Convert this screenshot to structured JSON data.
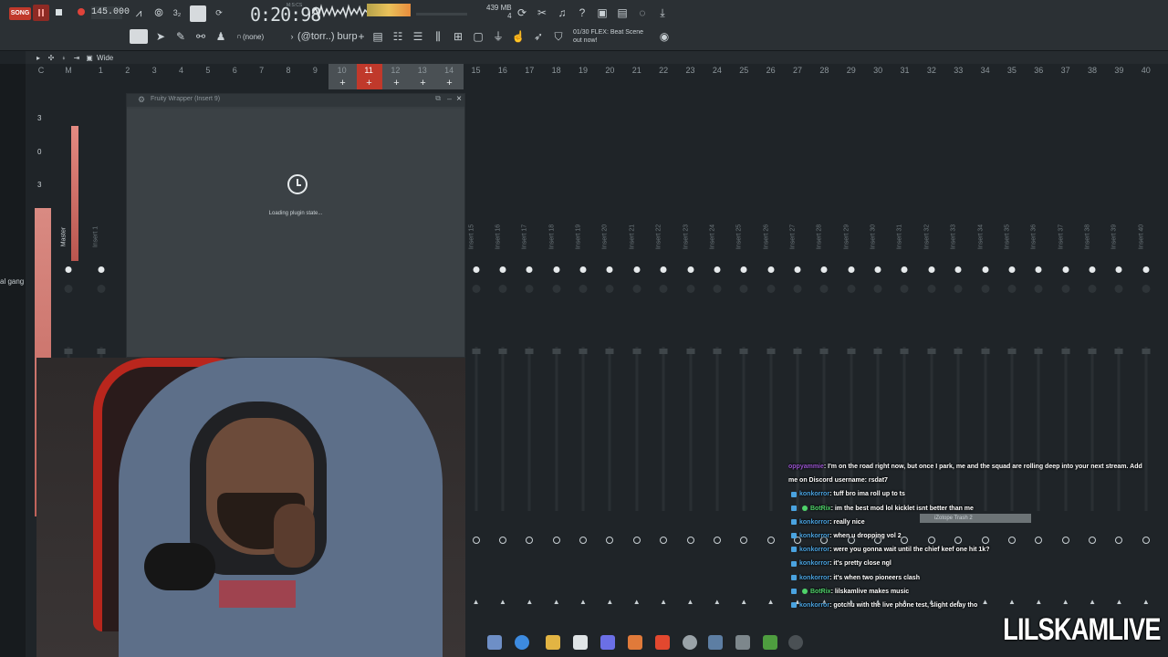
{
  "toolbar": {
    "song_label": "SONG",
    "tempo": "145.000",
    "time": "0:20:98",
    "time_unit": "M:S:CS",
    "memory": "439 MB",
    "cpu_count": "4",
    "snap_label": "(none)",
    "pattern_name": "(@torr..) burp",
    "news_line1": "01/30  FLEX: Beat Scene",
    "news_line2": "out now!",
    "mixer_view": "Wide"
  },
  "mixer": {
    "master_label": "Master",
    "level_marks": [
      "3",
      "0",
      "3"
    ],
    "side_label": "al gang",
    "track_numbers": [
      "C",
      "M",
      "1",
      "2",
      "3",
      "4",
      "5",
      "6",
      "7",
      "8",
      "9",
      "10",
      "11",
      "12",
      "13",
      "14",
      "15",
      "16",
      "17",
      "18",
      "19",
      "20",
      "21",
      "22",
      "23",
      "24",
      "25",
      "26",
      "27",
      "28",
      "29",
      "30",
      "31",
      "32",
      "33",
      "34",
      "35",
      "36",
      "37",
      "38",
      "39",
      "40"
    ],
    "insert_labels": [
      "Insert 1",
      "Insert 15",
      "Insert 16",
      "Insert 17",
      "Insert 18",
      "Insert 19",
      "Insert 20",
      "Insert 21",
      "Insert 22",
      "Insert 23",
      "Insert 24",
      "Insert 25",
      "Insert 26",
      "Insert 27",
      "Insert 28",
      "Insert 29",
      "Insert 30",
      "Insert 31",
      "Insert 32",
      "Insert 33",
      "Insert 34",
      "Insert 35",
      "Insert 36",
      "Insert 37",
      "Insert 38",
      "Insert 39",
      "Insert 40"
    ],
    "selected_track": "11",
    "tooltip": "iZotope Trash 2"
  },
  "wrapper": {
    "title": "Fruity Wrapper (Insert 9)",
    "loading_text": "Loading plugin state..."
  },
  "chat": [
    {
      "user": "oppyammie",
      "text": ": I'm on the road right now, but once I park, me and the squad are rolling deep into your next stream. Add",
      "style": "purple"
    },
    {
      "user": "",
      "text": "me on Discord username: rsdat7",
      "style": "none"
    },
    {
      "user": "konkorror",
      "text": ": tuff bro ima roll up to ts",
      "style": "blue"
    },
    {
      "user": "BotRix",
      "text": ": im the best mod lol kicklet isnt better than me",
      "style": "bot"
    },
    {
      "user": "konkorror",
      "text": ": really nice",
      "style": "blue"
    },
    {
      "user": "konkorror",
      "text": ": when u dropping vol 2",
      "style": "blue"
    },
    {
      "user": "konkorror",
      "text": ": were you gonna wait until the chief keef one hit 1k?",
      "style": "blue"
    },
    {
      "user": "konkorror",
      "text": ": it's pretty close ngl",
      "style": "blue"
    },
    {
      "user": "konkorror",
      "text": ": it's when two pioneers clash",
      "style": "blue"
    },
    {
      "user": "BotRix",
      "text": ": lilskamlive makes music",
      "style": "bot"
    },
    {
      "user": "konkorror",
      "text": ": gotchu with the live phone test, slight delay tho",
      "style": "blue"
    }
  ],
  "watermark": "LILSKAMLIVE",
  "colors": {
    "accent": "#c0392b",
    "chat_user": "#4aa3e0",
    "bot_user": "#4fd36a"
  }
}
